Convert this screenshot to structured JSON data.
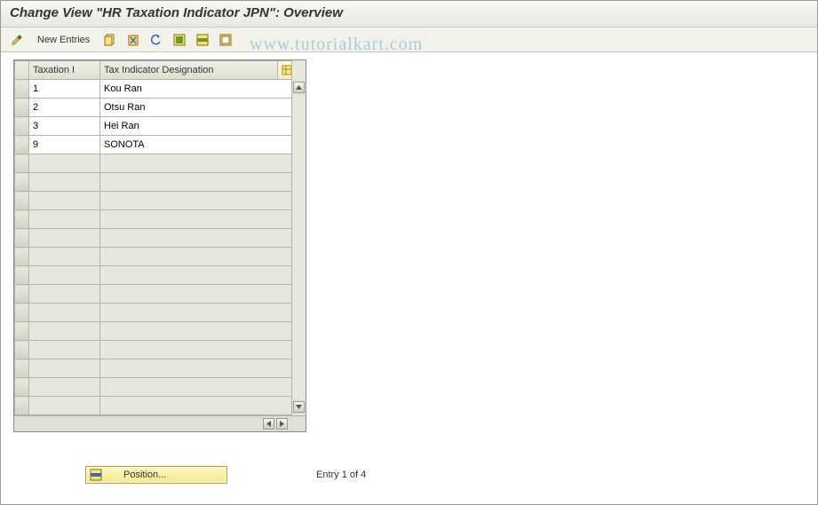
{
  "title": "Change View \"HR Taxation Indicator JPN\": Overview",
  "toolbar": {
    "new_entries": "New Entries",
    "icons": {
      "pencil": "edit-pencil-icon",
      "copy": "copy-icon",
      "delete": "delete-icon",
      "undo": "undo-icon",
      "select_all": "select-all-icon",
      "select_block": "select-block-icon",
      "deselect": "deselect-icon"
    }
  },
  "table": {
    "headers": {
      "col1": "Taxation I",
      "col2": "Tax Indicator Designation"
    },
    "rows": [
      {
        "id": "1",
        "desig": "Kou Ran"
      },
      {
        "id": "2",
        "desig": "Otsu Ran"
      },
      {
        "id": "3",
        "desig": "Hei Ran"
      },
      {
        "id": "9",
        "desig": "SONOTA"
      }
    ],
    "empty_rows": 14
  },
  "footer": {
    "position_label": "Position...",
    "status": "Entry 1 of 4"
  },
  "watermark": "www.tutorialkart.com"
}
